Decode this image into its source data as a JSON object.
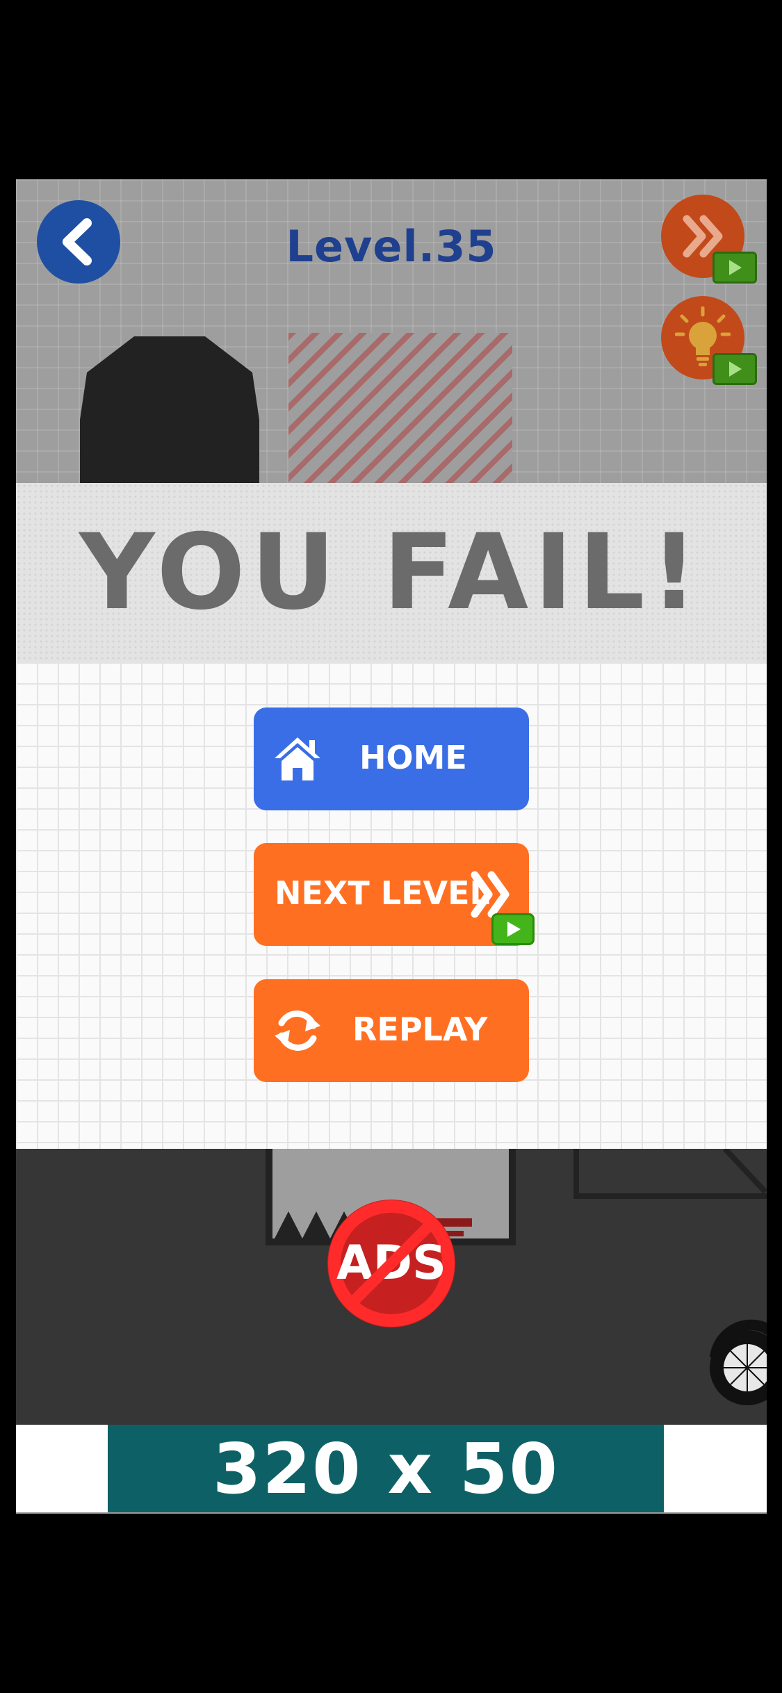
{
  "header": {
    "level_title": "Level.35"
  },
  "result": {
    "title": "YOU FAIL!"
  },
  "menu": {
    "home_label": "HOME",
    "next_level_label": "NEXT LEVEL",
    "replay_label": "REPLAY"
  },
  "remove_ads": {
    "label": "ADS"
  },
  "ad_banner": {
    "text": "320 x 50"
  },
  "icons": {
    "back": "chevron-left-icon",
    "skip": "double-chevron-right-icon",
    "hint": "lightbulb-icon",
    "video": "video-play-icon",
    "home": "home-icon",
    "replay": "refresh-icon"
  },
  "colors": {
    "home_button": "#3a6ee6",
    "orange_button": "#ff6f22",
    "level_title": "#1f3f8f",
    "ad_background": "#0d6166"
  }
}
